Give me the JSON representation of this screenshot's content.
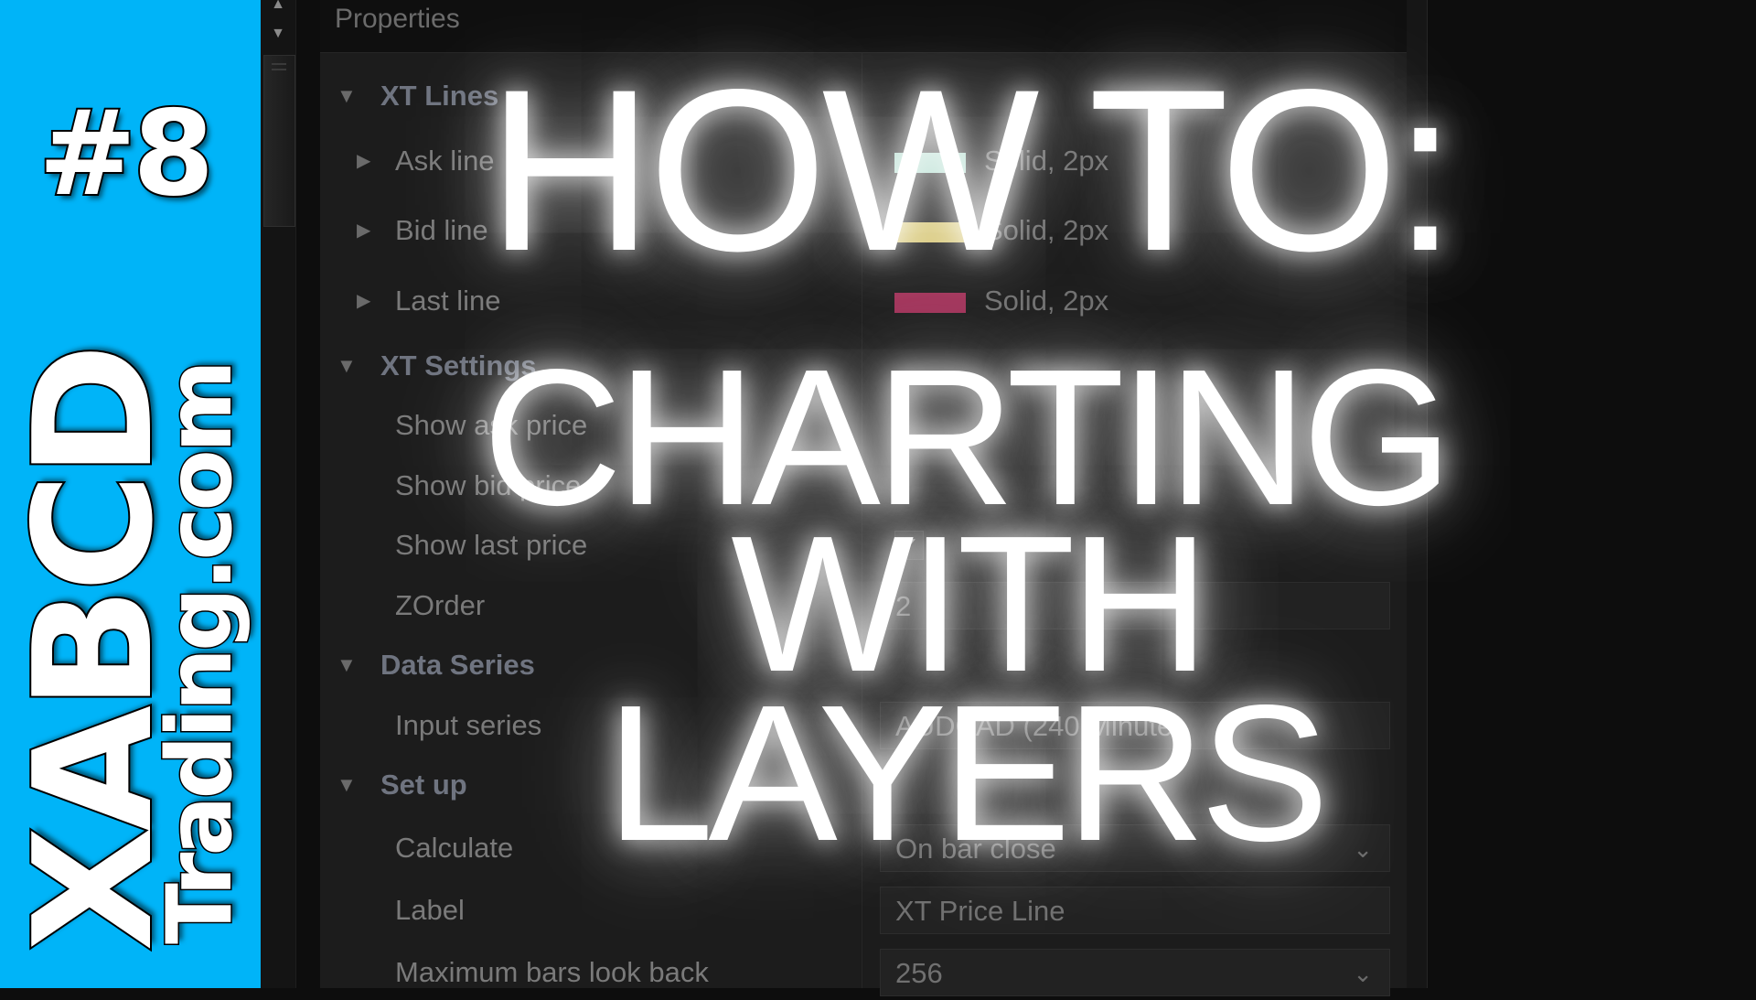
{
  "brand": {
    "episode": "#8",
    "name": "XABCD",
    "site": "Trading.com",
    "color": "#00b4f8"
  },
  "title": {
    "lines": [
      "HOW TO:",
      "CHARTING",
      "WITH",
      "LAYERS"
    ]
  },
  "scrollbar": {
    "up_icon": "▲",
    "down_icon": "▼"
  },
  "panel": {
    "title": "Properties",
    "icons": {
      "expanded": "▼",
      "collapsed": "▶",
      "chevron": "⌄",
      "check": "✔"
    },
    "rows": [
      {
        "type": "category",
        "label": "XT Lines"
      },
      {
        "type": "sub",
        "label": "Ask line",
        "value": "Solid, 2px",
        "swatch": "#a8d8c8"
      },
      {
        "type": "sub",
        "label": "Bid line",
        "value": "Solid, 2px",
        "swatch": "#d8c878"
      },
      {
        "type": "sub",
        "label": "Last line",
        "value": "Solid, 2px",
        "swatch": "#a03058"
      },
      {
        "type": "category",
        "label": "XT Settings"
      },
      {
        "type": "prop",
        "label": "Show ask price",
        "value": ""
      },
      {
        "type": "prop",
        "label": "Show bid price",
        "value": ""
      },
      {
        "type": "prop",
        "label": "Show last price",
        "checked": true
      },
      {
        "type": "prop",
        "label": "ZOrder",
        "value": "2"
      },
      {
        "type": "category",
        "label": "Data Series"
      },
      {
        "type": "prop",
        "label": "Input series",
        "value": "AUDCAD (240 Minute)"
      },
      {
        "type": "category",
        "label": "Set up"
      },
      {
        "type": "prop",
        "label": "Calculate",
        "value": "On bar close",
        "dropdown": true
      },
      {
        "type": "prop",
        "label": "Label",
        "value": "XT Price Line"
      },
      {
        "type": "prop",
        "label": "Maximum bars look back",
        "value": "256",
        "dropdown": true
      }
    ]
  }
}
